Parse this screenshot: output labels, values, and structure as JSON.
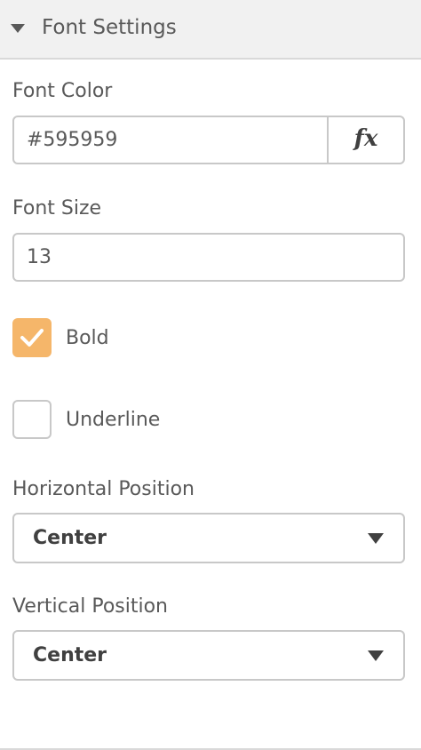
{
  "section": {
    "title": "Font Settings",
    "expanded_icon": "caret-down-icon"
  },
  "font_color": {
    "label": "Font Color",
    "value": "#595959",
    "expression_button": "fx"
  },
  "font_size": {
    "label": "Font Size",
    "value": "13"
  },
  "bold": {
    "label": "Bold",
    "checked": true
  },
  "underline": {
    "label": "Underline",
    "checked": false
  },
  "horizontal_position": {
    "label": "Horizontal Position",
    "selected": "Center"
  },
  "vertical_position": {
    "label": "Vertical Position",
    "selected": "Center"
  },
  "colors": {
    "text": "#595959",
    "checkbox_checked": "#f5b66a",
    "border": "#c8c8c8",
    "header_bg": "#f1f1f1"
  }
}
